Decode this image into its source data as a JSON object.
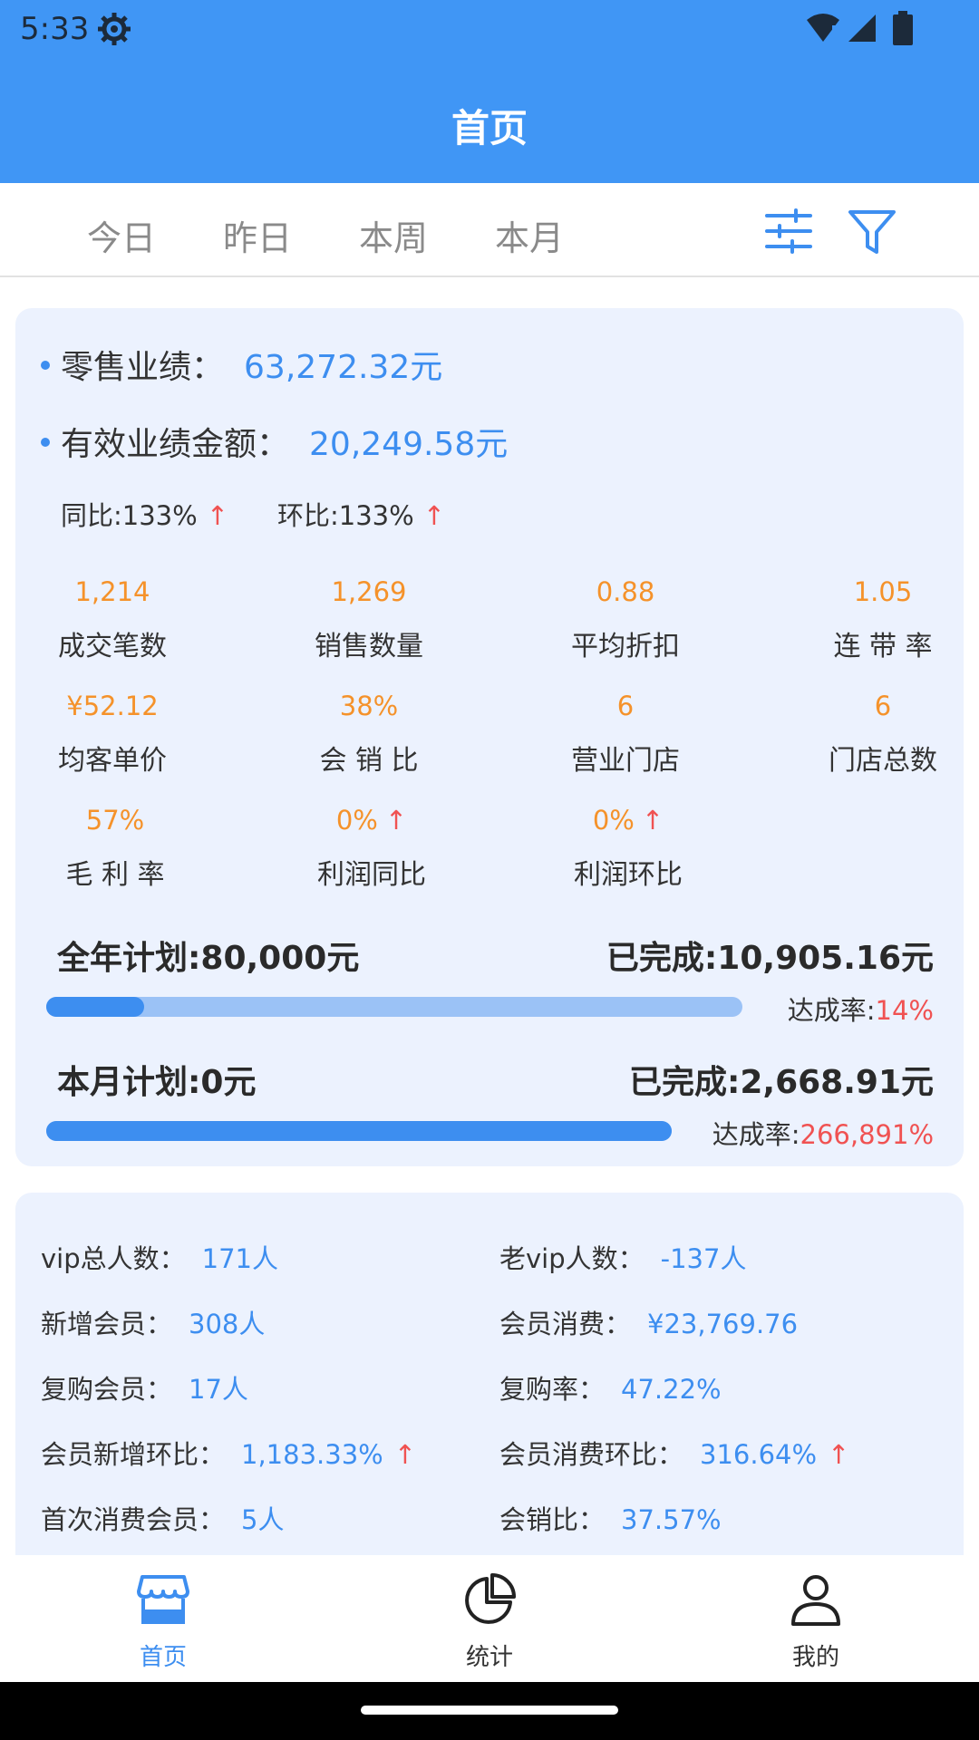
{
  "status_bar": {
    "time": "5:33"
  },
  "header": {
    "title": "首页"
  },
  "tabs": [
    {
      "label": "今日"
    },
    {
      "label": "昨日"
    },
    {
      "label": "本周"
    },
    {
      "label": "本月"
    }
  ],
  "performance": {
    "retail_label": "零售业绩：",
    "retail_value": "63,272.32元",
    "effective_label": "有效业绩金额：",
    "effective_value": "20,249.58元",
    "yoy_text": "同比:133%",
    "mom_text": "环比:133%",
    "up_arrow": "↑"
  },
  "stats": [
    {
      "value": "1,214",
      "label": "成交笔数"
    },
    {
      "value": "1,269",
      "label": "销售数量"
    },
    {
      "value": "0.88",
      "label": "平均折扣"
    },
    {
      "value": "1.05",
      "label": "连 带 率"
    },
    {
      "value": "¥52.12",
      "label": "均客单价"
    },
    {
      "value": "38%",
      "label": "会 销 比"
    },
    {
      "value": "6",
      "label": "营业门店"
    },
    {
      "value": "6",
      "label": "门店总数"
    },
    {
      "value": "57%",
      "label": "毛 利 率"
    },
    {
      "value": "0%",
      "label": "利润同比"
    },
    {
      "value": "0%",
      "label": "利润环比"
    }
  ],
  "plans": {
    "annual": {
      "title": "全年计划:80,000元",
      "done": "已完成:10,905.16元",
      "rate_label": "达成率:",
      "rate_value": "14%",
      "progress": 0.14
    },
    "monthly": {
      "title": "本月计划:0元",
      "done": "已完成:2,668.91元",
      "rate_label": "达成率:",
      "rate_value": "266,891%",
      "progress": 1.0
    }
  },
  "members": {
    "vip_total_label": "vip总人数：",
    "vip_total_value": "171人",
    "old_vip_label": "老vip人数：",
    "old_vip_value": "-137人",
    "new_member_label": "新增会员：",
    "new_member_value": "308人",
    "member_spend_label": "会员消费：",
    "member_spend_value": "¥23,769.76",
    "repurchase_member_label": "复购会员：",
    "repurchase_member_value": "17人",
    "repurchase_rate_label": "复购率：",
    "repurchase_rate_value": "47.22%",
    "new_mom_label": "会员新增环比：",
    "new_mom_value": "1,183.33%",
    "spend_mom_label": "会员消费环比：",
    "spend_mom_value": "316.64%",
    "first_spend_label": "首次消费会员：",
    "first_spend_value": "5人",
    "sales_ratio_label": "会销比：",
    "sales_ratio_value": "37.57%"
  },
  "bottom_nav": [
    {
      "label": "首页",
      "icon": "store-icon",
      "active": true
    },
    {
      "label": "统计",
      "icon": "pie-chart-icon",
      "active": false
    },
    {
      "label": "我的",
      "icon": "person-icon",
      "active": false
    }
  ],
  "colors": {
    "primary": "#4096f5",
    "accent_orange": "#f5922a",
    "up_red": "#f05252",
    "card_bg": "#ecf2fe"
  }
}
